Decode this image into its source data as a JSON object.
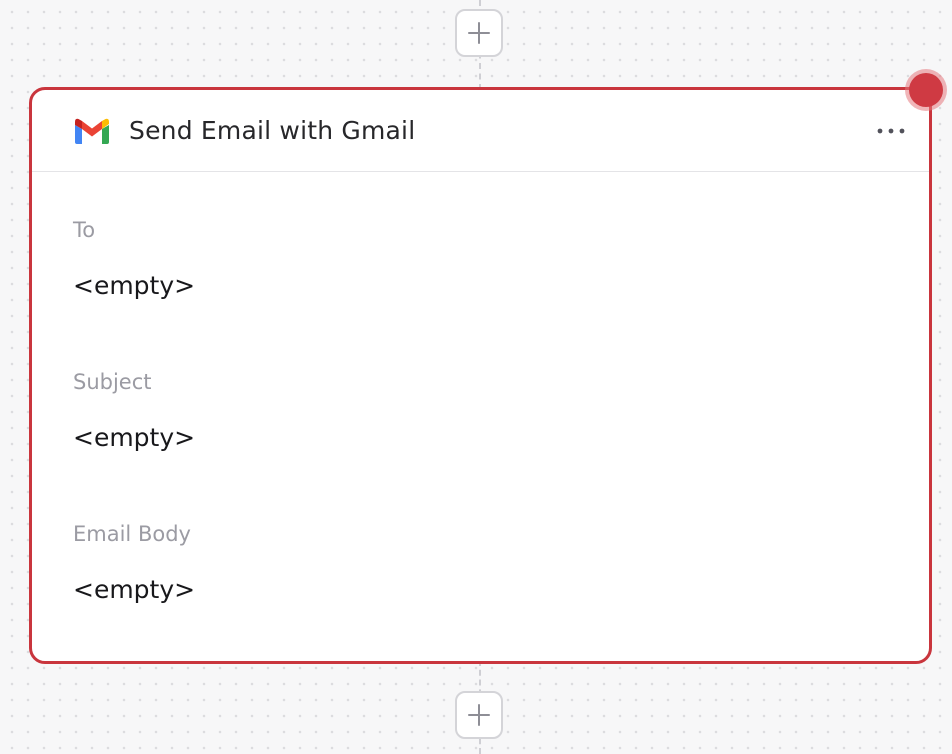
{
  "node": {
    "app_icon": "gmail-icon",
    "title": "Send Email with Gmail",
    "menu_icon": "more-horizontal-icon",
    "status_color": "#cf3a43",
    "border_color": "#c9353d",
    "fields": [
      {
        "label": "To",
        "value": "<empty>"
      },
      {
        "label": "Subject",
        "value": "<empty>"
      },
      {
        "label": "Email Body",
        "value": "<empty>"
      }
    ]
  },
  "connectors": {
    "add_icon": "plus-icon"
  }
}
